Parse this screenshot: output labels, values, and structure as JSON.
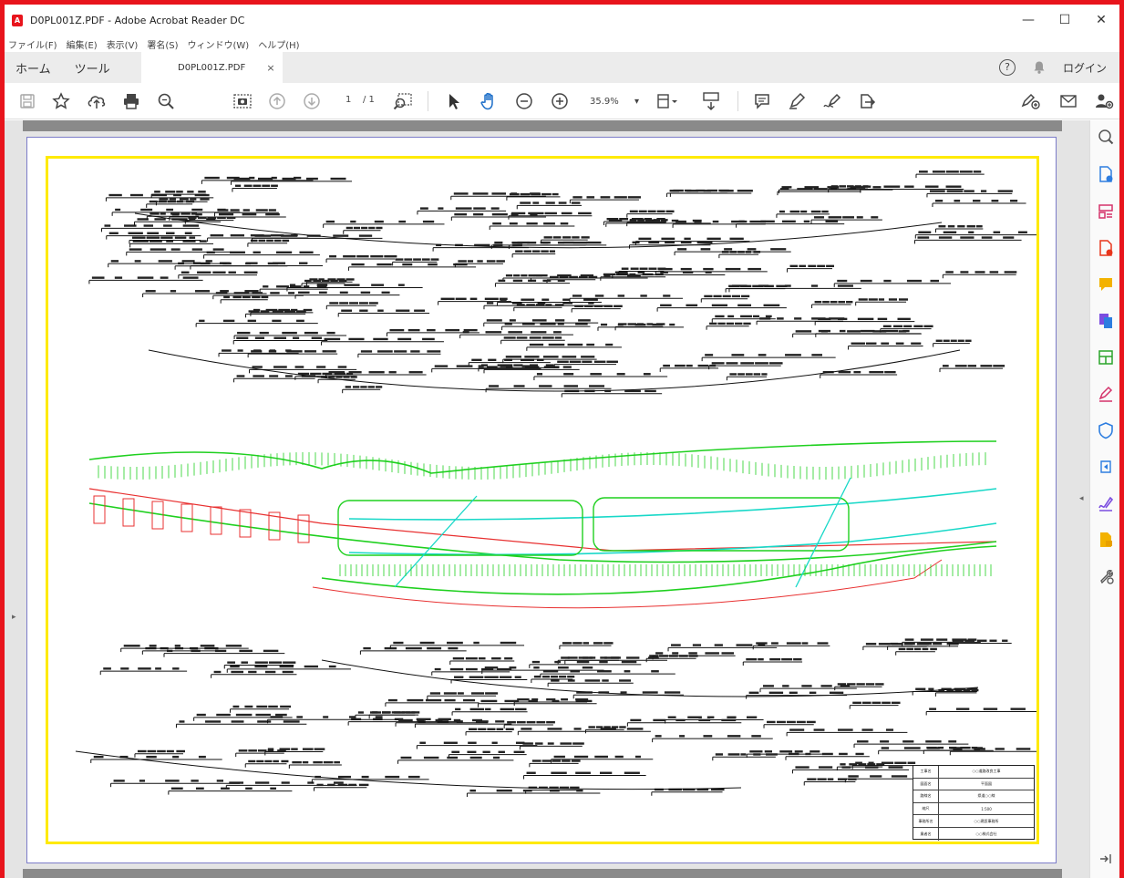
{
  "window": {
    "title": "D0PL001Z.PDF - Adobe Acrobat Reader DC",
    "minimize_glyph": "—",
    "maximize_glyph": "☐",
    "close_glyph": "✕"
  },
  "menu": [
    "ファイル(F)",
    "編集(E)",
    "表示(V)",
    "署名(S)",
    "ウィンドウ(W)",
    "ヘルプ(H)"
  ],
  "tabs": {
    "home": "ホーム",
    "tools": "ツール",
    "document": "D0PL001Z.PDF",
    "close_glyph": "×"
  },
  "account": {
    "login": "ログイン",
    "help_glyph": "?"
  },
  "toolbar": {
    "page_current": "1",
    "page_total": "/ 1",
    "zoom": "35.9%",
    "zoom_caret": "▾"
  },
  "icons": {
    "toolbar": [
      "save-icon",
      "bookmark-star-icon",
      "upload-icon",
      "print-icon",
      "zoom-search-icon",
      "snapshot-icon",
      "prev-page-icon",
      "next-page-icon",
      "marquee-zoom-icon",
      "select-cursor-icon",
      "hand-tool-icon",
      "zoom-out-icon",
      "zoom-in-icon",
      "fit-page-icon",
      "page-display-icon",
      "comment-icon",
      "highlight-pen-icon",
      "sign-icon",
      "share-icon",
      "fill-sign-icon",
      "email-icon",
      "add-user-icon"
    ],
    "sidebar": [
      "search-zoom-icon",
      "create-pdf-icon",
      "organize-pages-icon",
      "export-pdf-icon",
      "comment-panel-icon",
      "combine-files-icon",
      "edit-pdf-icon",
      "fill-sign-panel-icon",
      "protect-icon",
      "send-for-review-icon",
      "sign-panel-icon",
      "export-file-icon",
      "more-tools-icon"
    ]
  },
  "title_block": {
    "rows": [
      {
        "label": "工事名",
        "value": "○○道路改良工事"
      },
      {
        "label": "図面名",
        "value": "平面図"
      },
      {
        "label": "路線名",
        "value": "県道○○線"
      },
      {
        "label": "縮尺",
        "value": "1:500"
      },
      {
        "label": "事務所名",
        "value": "○○建設事務所"
      },
      {
        "label": "業者名",
        "value": "○○株式会社"
      }
    ]
  },
  "colors": {
    "frame": "#e8141c",
    "drawing_border": "#ffea00",
    "road_green": "#1fd01f",
    "road_cyan": "#18d8c8",
    "boundary_red": "#e83030"
  }
}
